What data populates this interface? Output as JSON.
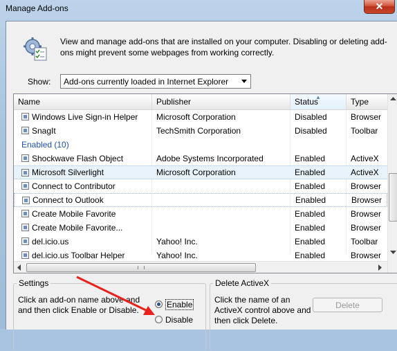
{
  "window": {
    "title": "Manage Add-ons",
    "close_label": "✕"
  },
  "description": "View and manage add-ons that are installed on your computer. Disabling or deleting add-ons might prevent some webpages from working correctly.",
  "show": {
    "label": "Show:",
    "value": "Add-ons currently loaded in Internet Explorer"
  },
  "table": {
    "headers": {
      "name": "Name",
      "publisher": "Publisher",
      "status": "Status",
      "type": "Type"
    },
    "rows_top": [
      {
        "name": "Windows Live Sign-in Helper",
        "publisher": "Microsoft Corporation",
        "status": "Disabled",
        "type": "Browser"
      },
      {
        "name": "SnagIt",
        "publisher": "TechSmith Corporation",
        "status": "Disabled",
        "type": "Toolbar"
      }
    ],
    "group_label": "Enabled (10)",
    "rows_enabled": [
      {
        "name": "Shockwave Flash Object",
        "publisher": "Adobe Systems Incorporated",
        "status": "Enabled",
        "type": "ActiveX"
      },
      {
        "name": "Microsoft Silverlight",
        "publisher": "Microsoft Corporation",
        "status": "Enabled",
        "type": "ActiveX"
      },
      {
        "name": "Connect to Contributor",
        "publisher": "",
        "status": "Enabled",
        "type": "Browser"
      },
      {
        "name": "Connect to Outlook",
        "publisher": "",
        "status": "Enabled",
        "type": "Browser"
      },
      {
        "name": "Create Mobile Favorite",
        "publisher": "",
        "status": "Enabled",
        "type": "Browser"
      },
      {
        "name": "Create Mobile Favorite...",
        "publisher": "",
        "status": "Enabled",
        "type": "Browser"
      },
      {
        "name": "del.icio.us",
        "publisher": "Yahoo! Inc.",
        "status": "Enabled",
        "type": "Toolbar"
      },
      {
        "name": "del.icio.us Toolbar Helper",
        "publisher": "Yahoo! Inc.",
        "status": "Enabled",
        "type": "Browser"
      }
    ]
  },
  "settings": {
    "legend": "Settings",
    "text": "Click an add-on name above and and then click Enable or Disable.",
    "enable_label": "Enable",
    "disable_label": "Disable",
    "selected": "Enable"
  },
  "activex": {
    "legend": "Delete ActiveX",
    "text": "Click the name of an ActiveX control above and then click Delete.",
    "delete_label": "Delete"
  },
  "colors": {
    "annotation_arrow": "#e8231c",
    "group_label": "#1e4fa8"
  }
}
